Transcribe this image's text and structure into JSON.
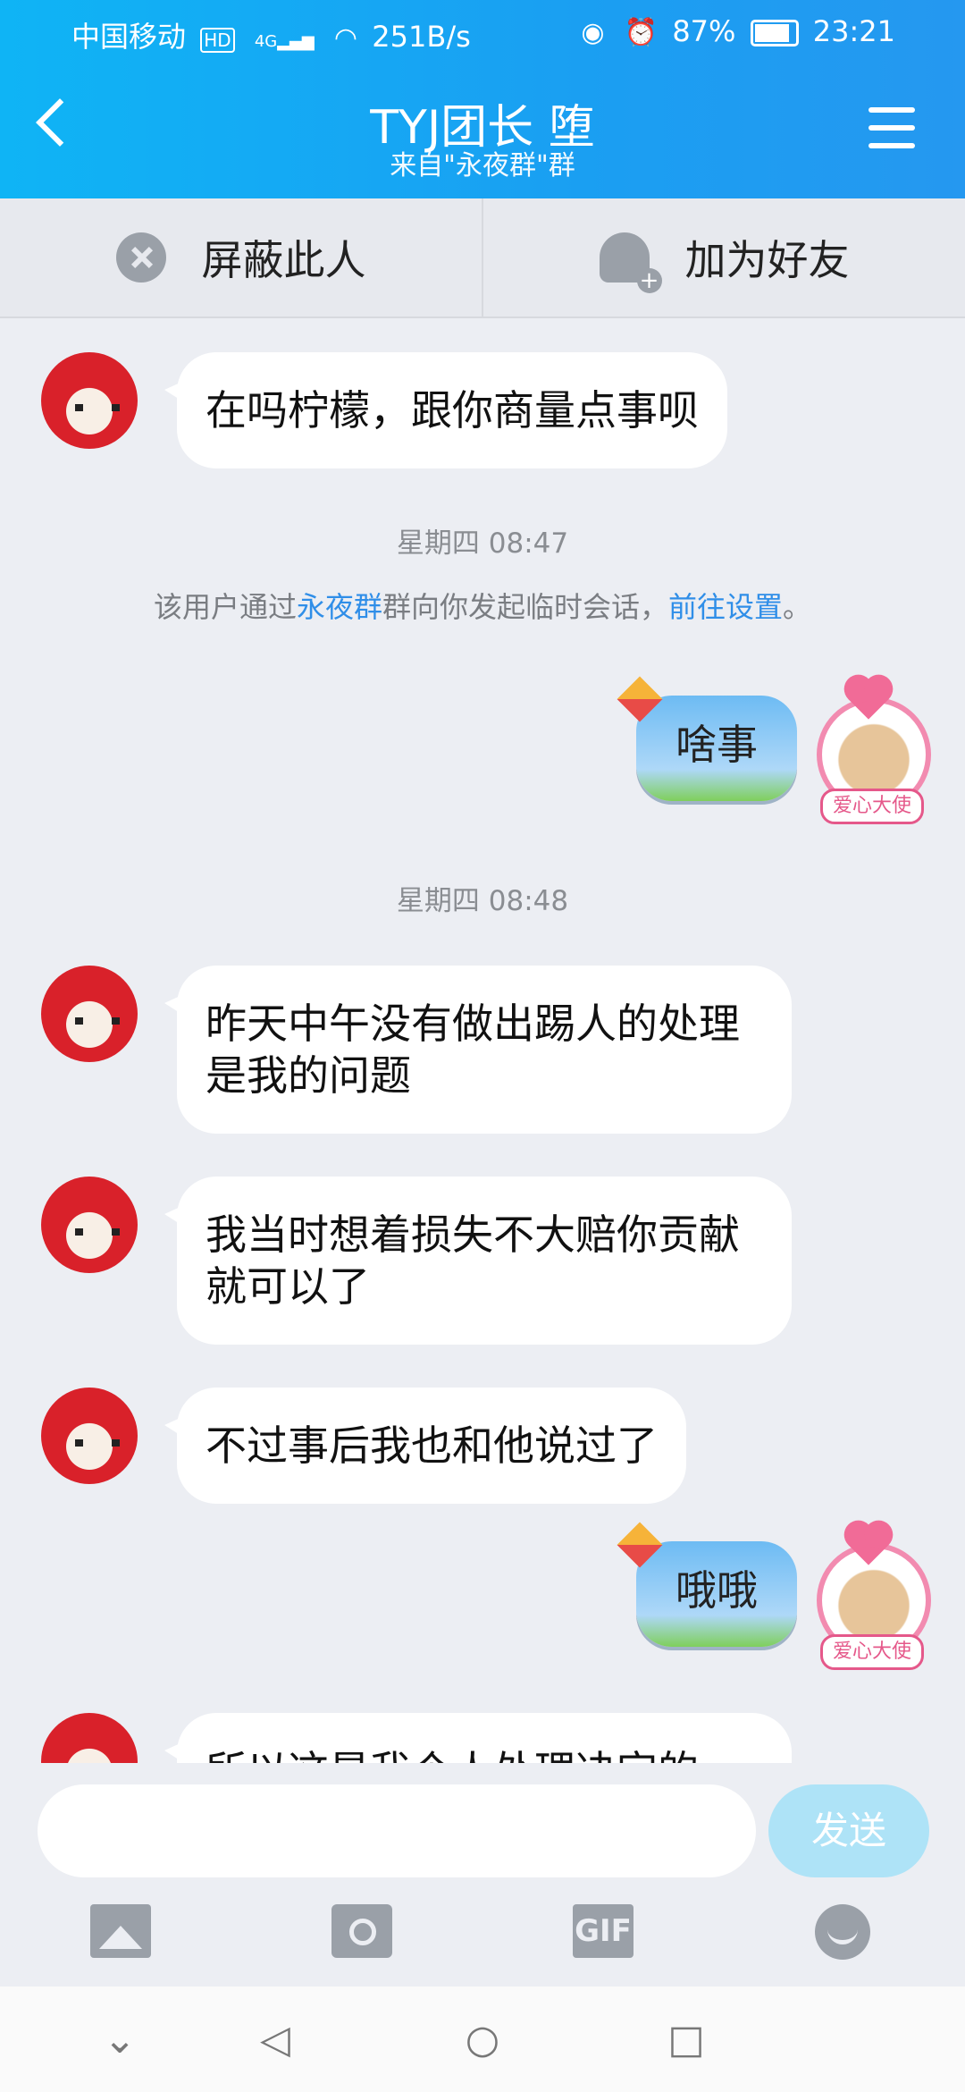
{
  "status_bar": {
    "carrier": "中国移动",
    "hd": "HD",
    "network": "4G",
    "speed": "251B/s",
    "battery": "87%",
    "battery_fraction": 0.87,
    "time": "23:21"
  },
  "header": {
    "title": "TYJ团长 堕",
    "subtitle": "来自\"永夜群\"群"
  },
  "action_bar": {
    "block_label": "屏蔽此人",
    "add_friend_label": "加为好友"
  },
  "messages": [
    {
      "text": "在吗柠檬，跟你商量点事呗"
    },
    {
      "time": "星期四 08:47"
    },
    {
      "notice_pre": "该用户通过",
      "notice_link1": "永夜群",
      "notice_mid": "群向你发起临时会话，",
      "notice_link2": "前往设置",
      "notice_end": "。"
    },
    {
      "text": "啥事"
    },
    {
      "time": "星期四 08:48"
    },
    {
      "text": "昨天中午没有做出踢人的处理是我的问题"
    },
    {
      "text": "我当时想着损失不大赔你贡献就可以了"
    },
    {
      "text": "不过事后我也和他说过了"
    },
    {
      "text": "哦哦"
    },
    {
      "text": "所以这是我个人处理决定的"
    }
  ],
  "my_avatar_badge": "爱心大使",
  "input": {
    "placeholder": "",
    "send_label": "发送"
  },
  "toolbar": {
    "gif_label": "GIF"
  },
  "colors": {
    "header": "#1a9ff2",
    "link": "#2f8ee8",
    "send_button": "#aee3f7"
  }
}
